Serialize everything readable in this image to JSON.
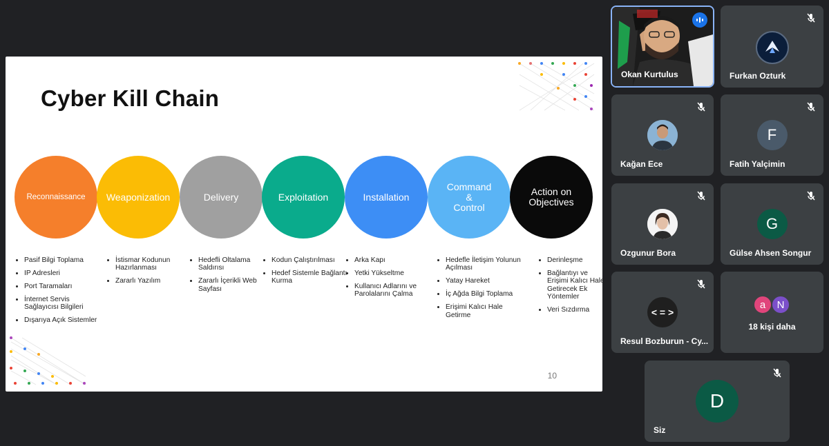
{
  "slide": {
    "title": "Cyber Kill Chain",
    "page_number": "10",
    "stages": [
      {
        "label": "Reconnaissance",
        "color": "#f57f2b",
        "bullets": [
          "Pasif Bilgi Toplama",
          "IP Adresleri",
          "Port Taramaları",
          "İnternet Servis Sağlayıcısı Bilgileri",
          "Dışarıya Açık Sistemler"
        ]
      },
      {
        "label": "Weaponization",
        "color": "#fbbc05",
        "bullets": [
          "İstismar Kodunun Hazırlanması",
          "Zararlı Yazılım"
        ]
      },
      {
        "label": "Delivery",
        "color": "#a0a0a0",
        "bullets": [
          "Hedefli Oltalama Saldırısı",
          "Zararlı İçerikli Web Sayfası"
        ]
      },
      {
        "label": "Exploitation",
        "color": "#0aab8c",
        "bullets": [
          "Kodun Çalıştırılması",
          "Hedef Sistemle Bağlantı Kurma"
        ]
      },
      {
        "label": "Installation",
        "color": "#3d8ef5",
        "bullets": [
          "Arka Kapı",
          "Yetki Yükseltme",
          "Kullanıcı Adlarını ve Parolalarını Çalma"
        ]
      },
      {
        "label": "Command\n&\nControl",
        "color": "#5ab4f5",
        "bullets": [
          "Hedefle İletişim Yolunun Açılması",
          "Yatay Hareket",
          "İç Ağda Bilgi Toplama",
          "Erişimi Kalıcı Hale Getirme"
        ]
      },
      {
        "label": "Action on\nObjectives",
        "color": "#0a0a0a",
        "bullets": [
          "Derinleşme",
          "Bağlantıyı ve Erişimi Kalıcı Hale Getirecek Ek Yöntemler",
          "Veri Sızdırma"
        ]
      }
    ]
  },
  "participants": [
    {
      "name": "Okan Kurtulus",
      "type": "video",
      "speaking": true
    },
    {
      "name": "Furkan Ozturk",
      "type": "logo",
      "muted": true
    },
    {
      "name": "Kağan Ece",
      "type": "photo",
      "muted": true
    },
    {
      "name": "Fatih Yalçimin",
      "initial": "F",
      "color": "#4a5a6a",
      "muted": true
    },
    {
      "name": "Ozgunur Bora",
      "type": "photo",
      "muted": true
    },
    {
      "name": "Gülse Ahsen Songur",
      "initial": "G",
      "color": "#0b5a45",
      "muted": true
    },
    {
      "name": "Resul Bozburun - Cy...",
      "initial": "< = >",
      "color": "#1f1f1f",
      "muted": true
    },
    {
      "name": "Siz",
      "initial": "D",
      "color": "#0b5a45",
      "muted": true
    }
  ],
  "more_participants": {
    "label": "18 kişi daha",
    "avatars": [
      {
        "initial": "a",
        "color": "#e0457b"
      },
      {
        "initial": "N",
        "color": "#7b4fc9"
      }
    ]
  },
  "icons": {
    "mic_off": "mic-off-icon",
    "speaking": "audio-level-icon"
  }
}
